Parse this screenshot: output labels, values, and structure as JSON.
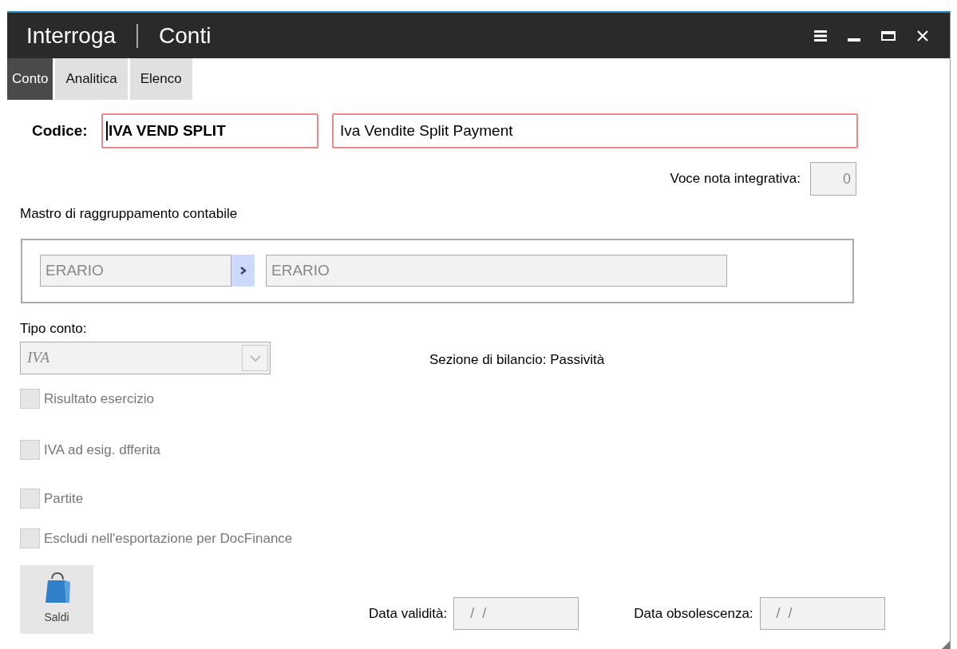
{
  "window": {
    "title_parts": [
      "Interroga",
      "Conti"
    ]
  },
  "tabs": [
    {
      "label": "Conto",
      "selected": true
    },
    {
      "label": "Analitica",
      "selected": false
    },
    {
      "label": "Elenco",
      "selected": false
    }
  ],
  "codice": {
    "label": "Codice:",
    "code": "IVA VEND SPLIT",
    "description": "Iva Vendite Split Payment"
  },
  "voce_nota": {
    "label": "Voce nota integrativa:",
    "value": "0"
  },
  "mastro": {
    "label": "Mastro di raggruppamento contabile",
    "code": "ERARIO",
    "description": "ERARIO"
  },
  "tipo_conto": {
    "label": "Tipo conto:",
    "value": "IVA",
    "disabled": true
  },
  "sezione": "Sezione di bilancio: Passività",
  "checkboxes": [
    {
      "label": "Risultato esercizio",
      "checked": false,
      "disabled": true
    },
    {
      "label": "IVA ad esig. dfferita",
      "checked": false,
      "disabled": true
    },
    {
      "label": "Partite",
      "checked": false,
      "disabled": true
    },
    {
      "label": "Escludi nell'esportazione per DocFinance",
      "checked": false,
      "disabled": true
    }
  ],
  "saldi_button": {
    "label": "Saldi"
  },
  "dates": [
    {
      "label": "Data validità:",
      "value": "/  /"
    },
    {
      "label": "Data obsolescenza:",
      "value": "/  /"
    }
  ]
}
